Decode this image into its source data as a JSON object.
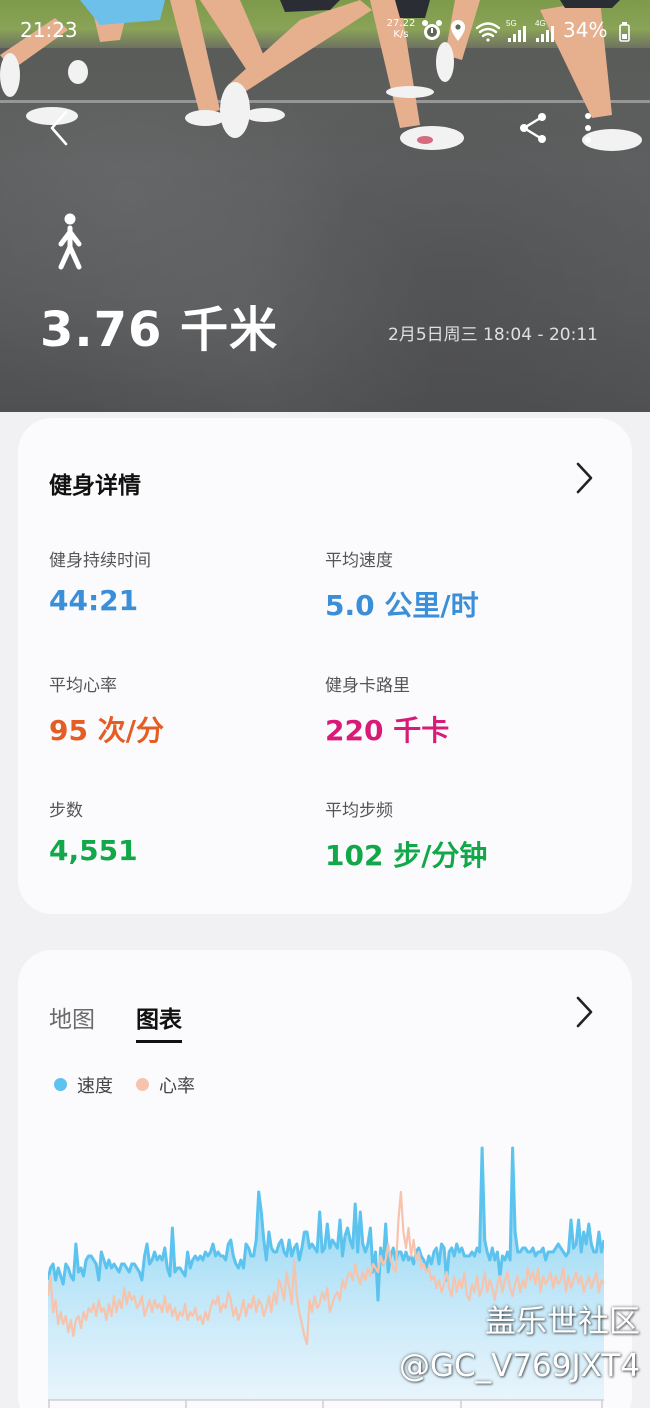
{
  "status_bar": {
    "time": "21:23",
    "net_speed_value": "27.22",
    "net_speed_unit": "K/s",
    "battery": "34%",
    "icons": [
      "alarm-icon",
      "location-icon",
      "wifi-icon",
      "signal-5g-icon",
      "signal-4g-icon",
      "battery-icon"
    ]
  },
  "header": {
    "activity_icon": "walk-icon",
    "distance": "3.76 千米",
    "date_range": "2月5日周三 18:04 - 20:11"
  },
  "details": {
    "title": "健身详情",
    "stats": [
      {
        "label": "健身持续时间",
        "value": "44:21",
        "color": "#3b8fd9"
      },
      {
        "label": "平均速度",
        "value": "5.0 公里/时",
        "color": "#3b8fd9"
      },
      {
        "label": "平均心率",
        "value": "95 次/分",
        "color": "#e35d24"
      },
      {
        "label": "健身卡路里",
        "value": "220 千卡",
        "color": "#d81b78"
      },
      {
        "label": "步数",
        "value": "4,551",
        "color": "#12a84a"
      },
      {
        "label": "平均步频",
        "value": "102 步/分钟",
        "color": "#12a84a"
      }
    ]
  },
  "chart_section": {
    "tabs": [
      "地图",
      "图表"
    ],
    "active_tab": "图表",
    "legend": [
      {
        "label": "速度",
        "color": "#5bc3ee"
      },
      {
        "label": "心率",
        "color": "#f6c4ad"
      }
    ]
  },
  "chart_data": {
    "type": "line",
    "title": "",
    "xlabel": "",
    "ylabel": "",
    "series": [
      {
        "name": "速度",
        "color": "#5bc3ee",
        "values": [
          30,
          33,
          34,
          30,
          33,
          31,
          29,
          34,
          33,
          31,
          30,
          39,
          32,
          33,
          31,
          35,
          36,
          36,
          35,
          34,
          30,
          37,
          35,
          33,
          35,
          33,
          34,
          33,
          32,
          34,
          34,
          33,
          32,
          34,
          34,
          33,
          32,
          30,
          36,
          39,
          34,
          35,
          37,
          35,
          36,
          35,
          38,
          33,
          31,
          43,
          32,
          33,
          33,
          32,
          31,
          37,
          33,
          35,
          36,
          35,
          36,
          35,
          37,
          36,
          37,
          39,
          36,
          37,
          36,
          36,
          35,
          39,
          40,
          36,
          34,
          33,
          35,
          33,
          39,
          38,
          36,
          36,
          40,
          52,
          47,
          40,
          35,
          42,
          38,
          37,
          37,
          39,
          40,
          37,
          36,
          40,
          36,
          38,
          39,
          35,
          38,
          42,
          42,
          38,
          39,
          38,
          37,
          47,
          37,
          38,
          44,
          38,
          40,
          39,
          38,
          45,
          36,
          41,
          43,
          40,
          38,
          49,
          37,
          47,
          39,
          37,
          39,
          43,
          32,
          37,
          25,
          38,
          34,
          44,
          32,
          36,
          38,
          35,
          37,
          37,
          35,
          37,
          35,
          36,
          34,
          37,
          38,
          36,
          35,
          33,
          36,
          34,
          37,
          38,
          34,
          39,
          38,
          30,
          37,
          38,
          36,
          39,
          37,
          38,
          36,
          36,
          36,
          37,
          36,
          38,
          37,
          63,
          40,
          37,
          35,
          38,
          35,
          37,
          31,
          36,
          35,
          37,
          35,
          63,
          42,
          37,
          37,
          38,
          38,
          37,
          37,
          38,
          36,
          37,
          37,
          38,
          35,
          37,
          37,
          37,
          38,
          39,
          38,
          37,
          36,
          37,
          45,
          38,
          39,
          45,
          37,
          42,
          39,
          44,
          39,
          37,
          37,
          42,
          37,
          40
        ]
      },
      {
        "name": "心率",
        "color": "#f6c4ad",
        "values": [
          26,
          31,
          22,
          25,
          19,
          22,
          19,
          21,
          17,
          20,
          16,
          20,
          21,
          18,
          22,
          20,
          23,
          22,
          24,
          21,
          25,
          22,
          23,
          20,
          24,
          21,
          26,
          22,
          25,
          23,
          28,
          24,
          27,
          25,
          26,
          23,
          24,
          26,
          21,
          23,
          25,
          22,
          25,
          23,
          24,
          22,
          26,
          22,
          24,
          21,
          23,
          20,
          22,
          21,
          24,
          20,
          22,
          21,
          23,
          20,
          21,
          19,
          22,
          20,
          23,
          25,
          24,
          26,
          22,
          24,
          23,
          27,
          25,
          21,
          23,
          20,
          22,
          25,
          21,
          24,
          23,
          26,
          22,
          25,
          24,
          21,
          23,
          26,
          22,
          27,
          24,
          30,
          28,
          25,
          32,
          28,
          24,
          35,
          26,
          22,
          19,
          16,
          14,
          25,
          22,
          26,
          23,
          24,
          27,
          25,
          28,
          22,
          24,
          26,
          27,
          25,
          30,
          28,
          31,
          32,
          30,
          34,
          31,
          29,
          32,
          30,
          33,
          31,
          34,
          33,
          32,
          36,
          34,
          35,
          39,
          35,
          33,
          32,
          45,
          52,
          42,
          38,
          43,
          36,
          40,
          35,
          37,
          33,
          34,
          32,
          33,
          30,
          31,
          28,
          30,
          27,
          29,
          32,
          28,
          26,
          31,
          27,
          30,
          28,
          32,
          26,
          25,
          29,
          27,
          31,
          26,
          28,
          32,
          27,
          30,
          28,
          25,
          29,
          31,
          27,
          30,
          32,
          28,
          26,
          29,
          31,
          27,
          30,
          28,
          33,
          30,
          32,
          29,
          33,
          27,
          31,
          29,
          30,
          32,
          28,
          31,
          29,
          30,
          33,
          27,
          31,
          28,
          30,
          32,
          29,
          31,
          27,
          29,
          31,
          28,
          30,
          32,
          27,
          30,
          29
        ]
      }
    ],
    "ylim": [
      0,
      70
    ],
    "grid": false,
    "legend_position": "top-left"
  },
  "watermark": {
    "line1": "盖乐世社区",
    "line2": "@GC_V769JXT4"
  }
}
